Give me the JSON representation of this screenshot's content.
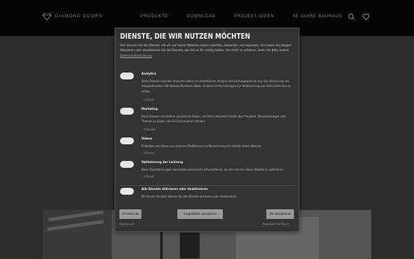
{
  "header": {
    "brand": "DIAMOND DOORS",
    "nav": [
      "PRODUKTE",
      "DOWNLOAD",
      "PROJEKT-IDEEN",
      "85 JAHRE BAUHAUS"
    ]
  },
  "consent": {
    "title": "DIENSTE, DIE WIR NUTZEN MÖCHTEN",
    "intro": "Hier können Sie die Dienste, die wir auf dieser Website nutzen möchten, bewerten und anpassen. Sie haben das Sagen! Aktivieren oder deaktivieren Sie die Dienste, wie Sie es für richtig halten. Um mehr zu erfahren, lesen Sie bitte unsere",
    "intro_link": "Datenschutzerklärung",
    "intro_end": ".",
    "services": [
      {
        "name": "Analytics",
        "description": "Diese Dienste sammeln anonyme Daten zur statistischen Analyse und Leistungsoptimierung. Die Aktivierung von Analysediensten hilft Website-Besitzern dabei, fundierte Entscheidungen zur Verbesserung von Online-Diensten zu treffen.",
        "count": "1 Dienst"
      },
      {
        "name": "Marketing",
        "description": "Diese Dienste verarbeiten persönliche Daten, um Ihnen relevante Inhalte über Produkte, Dienstleistungen oder Themen zu zeigen, die Sie interessieren könnten.",
        "count": "3 Dienste"
      },
      {
        "name": "Videos",
        "description": "Einbetten von Videos aus externen Plattformen zur Bereicherung der Inhalte dieser Website.",
        "count": "1 Dienst"
      },
      {
        "name": "Optimierung der Leistung",
        "description": "Diese Dienstleistungen verarbeiten persönliche Informationen, um den Service dieser Website zu optimieren.",
        "count": "1 Dienst"
      }
    ],
    "toggle_all": {
      "name": "Alle Dienste aktivieren oder deaktivieren",
      "description": "Mit diesem Schalter können Sie alle Dienste aktivieren oder deaktivieren."
    },
    "buttons": {
      "decline": "Ich lehne ab",
      "accept_selected": "Ausgewählte akzeptieren",
      "accept_all": "Alle akzeptieren"
    },
    "footer": {
      "imprint": "Impressum",
      "realized": "Realisiert mit Klaro!"
    }
  },
  "colors": {
    "modal_bg": "#333333",
    "toggle_off": "#e6e6e6",
    "button": "#9a9a9a",
    "topbar": "#050505"
  },
  "icons": [
    "diamond-logo-icon",
    "search-icon",
    "heart-icon"
  ]
}
